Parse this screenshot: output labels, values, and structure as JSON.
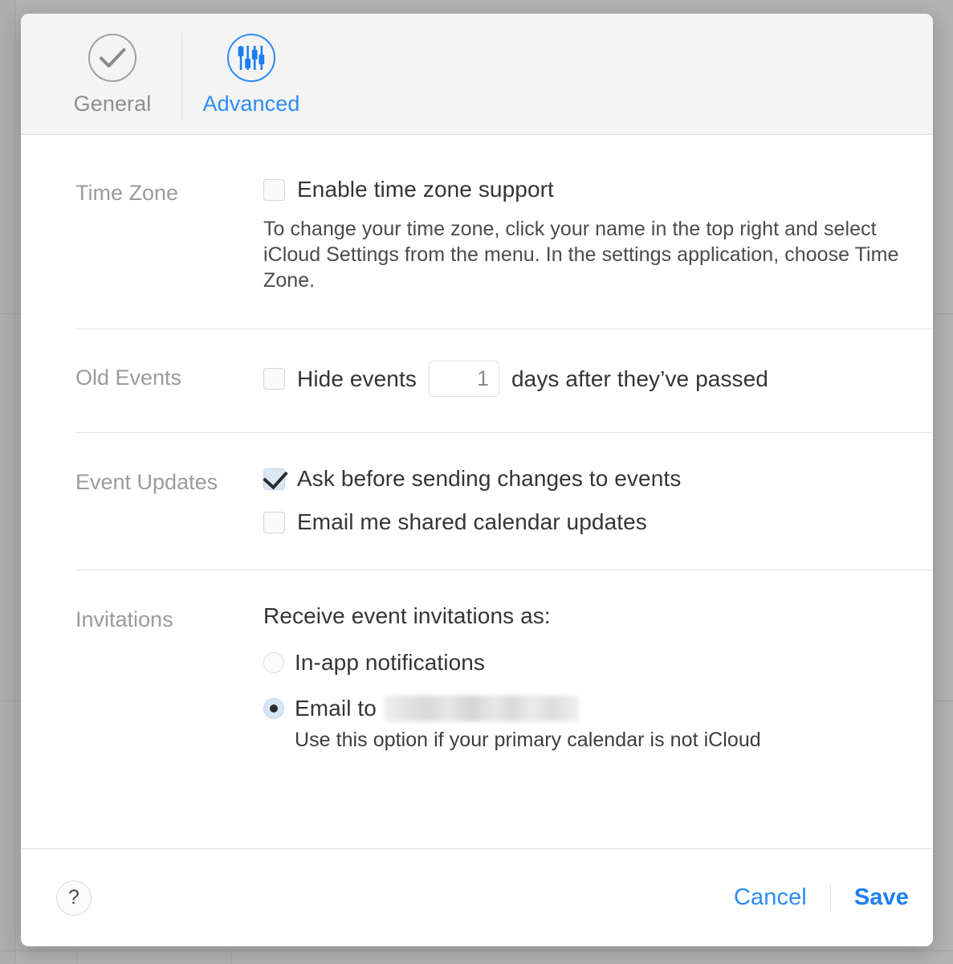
{
  "colors": {
    "accent": "#2e8bf7",
    "save_blue": "#1e7ef0",
    "label_gray": "#9b9b9b",
    "text_dark": "#353535",
    "backdrop": "#b2b2b2",
    "toolbar_bg": "#f4f4f4",
    "checked_fill": "#dae7f4"
  },
  "toolbar": {
    "items": [
      {
        "label": "General",
        "icon": "check-circle-icon",
        "active": false
      },
      {
        "label": "Advanced",
        "icon": "sliders-circle-icon",
        "active": true
      }
    ]
  },
  "sections": {
    "time_zone": {
      "label": "Time Zone",
      "checkbox": {
        "label": "Enable time zone support",
        "checked": false
      },
      "description": "To change your time zone, click your name in the top right and select iCloud Settings from the menu. In the settings application, choose Time Zone."
    },
    "old_events": {
      "label": "Old Events",
      "checkbox": {
        "label": "Hide events",
        "checked": false
      },
      "days_value": "1",
      "days_placeholder": "1",
      "suffix": "days after they’ve passed"
    },
    "event_updates": {
      "label": "Event Updates",
      "checkboxes": [
        {
          "label": "Ask before sending changes to events",
          "checked": true
        },
        {
          "label": "Email me shared calendar updates",
          "checked": false
        }
      ]
    },
    "invitations": {
      "label": "Invitations",
      "legend": "Receive event invitations as:",
      "options": [
        {
          "label": "In-app notifications",
          "selected": false
        },
        {
          "label": "Email to",
          "selected": true,
          "value_redacted": true
        }
      ],
      "note": "Use this option if your primary calendar is not iCloud"
    }
  },
  "footer": {
    "help_label": "?",
    "cancel_label": "Cancel",
    "save_label": "Save"
  }
}
